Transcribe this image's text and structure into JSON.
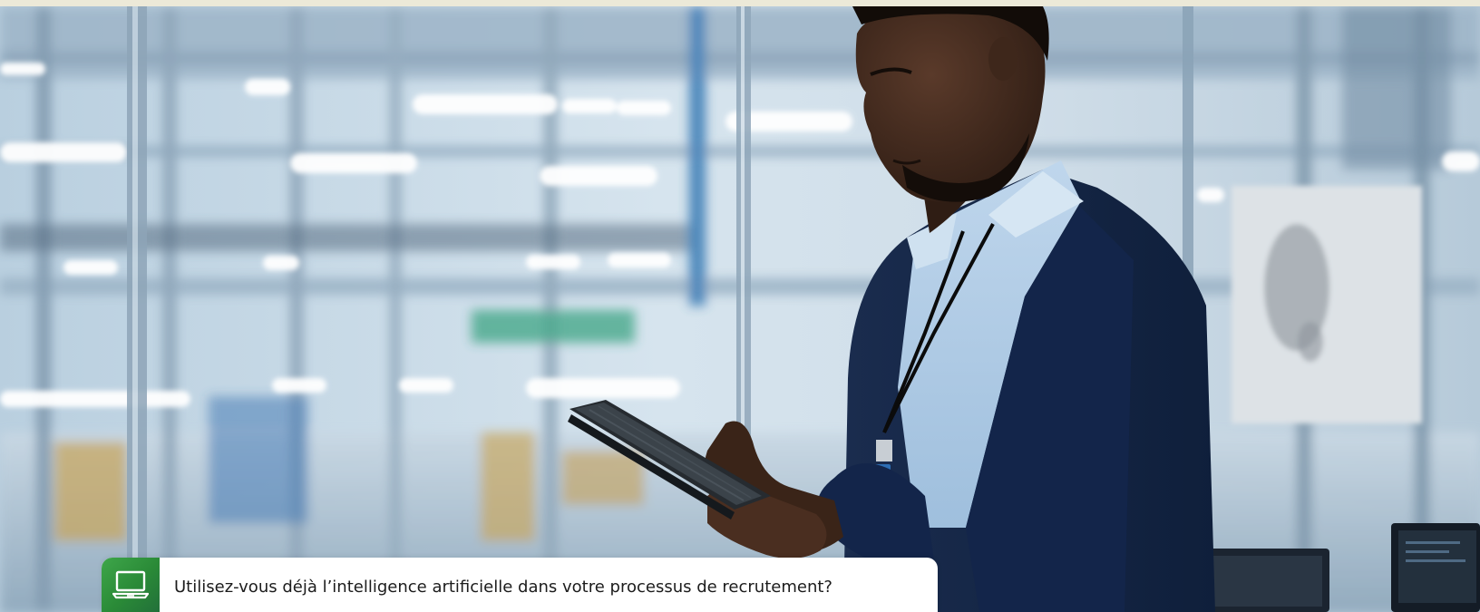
{
  "hero": {
    "image_subject": "man-with-tablet-in-factory"
  },
  "question": {
    "icon": "laptop-icon",
    "text": "Utilisez-vous déjà l’intelligence artificielle dans votre processus de recrutement?"
  },
  "colors": {
    "accent_green": "#2e9442",
    "card_background": "#ffffff",
    "text": "#1c1c1c",
    "top_strip": "#ece9d8"
  }
}
